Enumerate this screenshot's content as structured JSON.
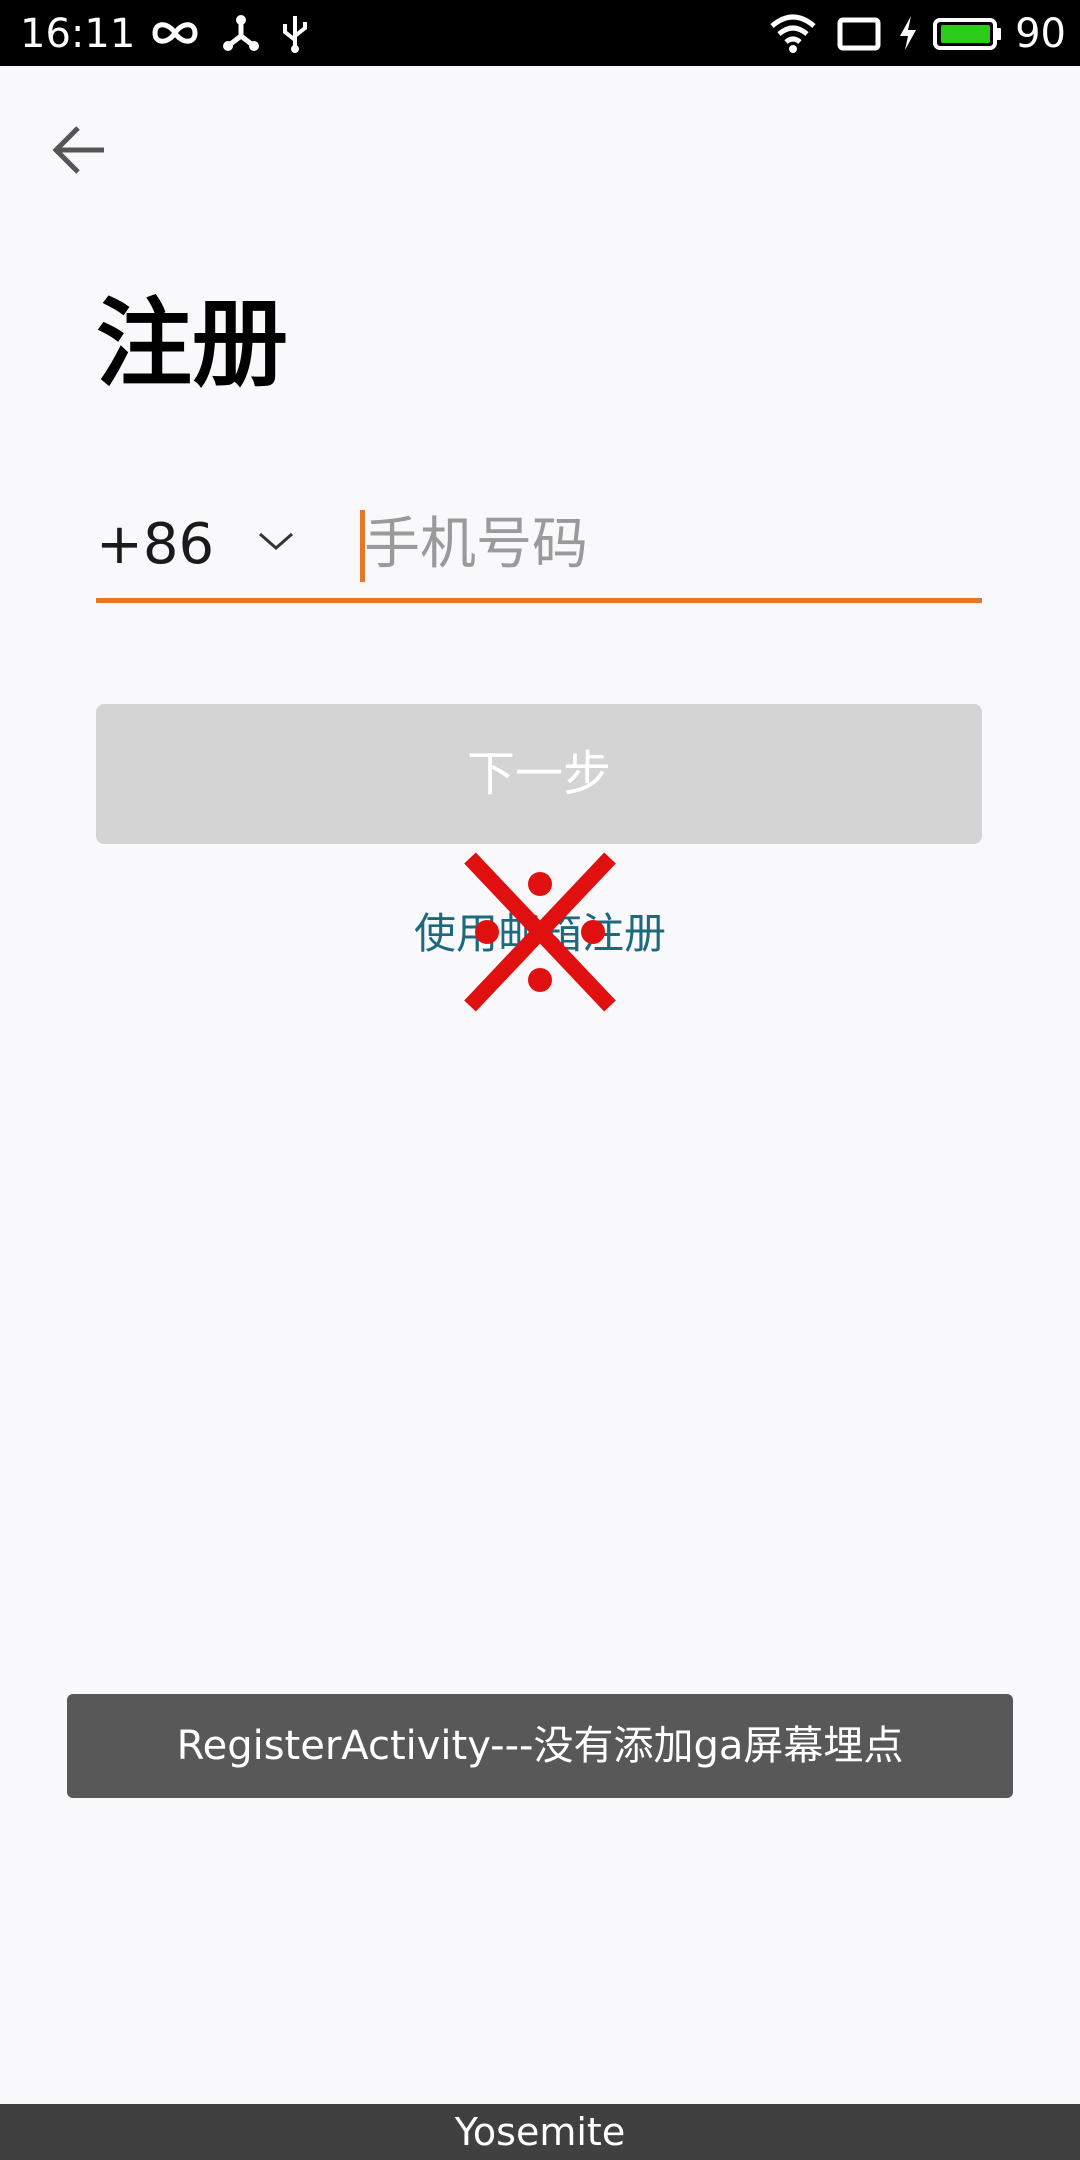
{
  "status_bar": {
    "time": "16:11",
    "battery_percent": "90",
    "icons": [
      "infinity-icon",
      "usb-debug-icon",
      "usb-icon",
      "wifi-icon",
      "screen-cast-icon",
      "charging-icon",
      "battery-icon"
    ],
    "battery_color": "#2ecc1a"
  },
  "header": {
    "back_icon": "back-arrow-icon"
  },
  "title": "注册",
  "phone": {
    "country_code": "+86",
    "placeholder": "手机号码",
    "value": "",
    "accent_color": "#e4772a"
  },
  "next_button": {
    "label": "下一步",
    "enabled": false
  },
  "email_register_link": "使用邮箱注册",
  "toast": "RegisterActivity---没有添加ga屏幕埋点",
  "bottom_bar": "Yosemite"
}
